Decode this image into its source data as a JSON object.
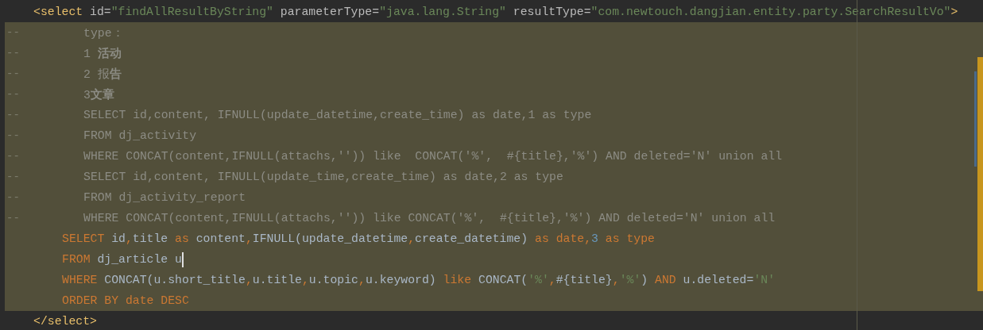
{
  "editor": {
    "lines": [
      {
        "kind": "tag",
        "caret": false,
        "tokens": [
          {
            "text": "<select",
            "kind": "tag"
          },
          {
            "text": " id=",
            "kind": "attr"
          },
          {
            "text": "\"findAllResultByString\"",
            "kind": "value"
          },
          {
            "text": " parameterType=",
            "kind": "attr"
          },
          {
            "text": "\"java.lang.String\"",
            "kind": "value"
          },
          {
            "text": " resultType=",
            "kind": "attr"
          },
          {
            "text": "\"com.newtouch.dangjian.entity.party.SearchResultVo\"",
            "kind": "value"
          },
          {
            "text": ">",
            "kind": "tag"
          }
        ]
      },
      {
        "kind": "comment",
        "caret": false,
        "marker": "--",
        "text": "type："
      },
      {
        "kind": "comment",
        "caret": false,
        "marker": "--",
        "text": "1 **活动**"
      },
      {
        "kind": "comment",
        "caret": false,
        "marker": "--",
        "text": "2 报**告**"
      },
      {
        "kind": "comment",
        "caret": false,
        "marker": "--",
        "text": "3**文章**"
      },
      {
        "kind": "comment",
        "caret": false,
        "marker": "--",
        "text": "SELECT id,content, IFNULL(update_datetime,create_time) as date,1 as type"
      },
      {
        "kind": "comment",
        "caret": false,
        "marker": "--",
        "text": "FROM dj_activity"
      },
      {
        "kind": "comment",
        "caret": false,
        "marker": "--",
        "text": "WHERE CONCAT(content,IFNULL(attachs,'')) like  CONCAT('%',  #{title},'%') AND deleted='N' union all"
      },
      {
        "kind": "comment",
        "caret": false,
        "marker": "--",
        "text": "SELECT id,content, IFNULL(update_time,create_time) as date,2 as type"
      },
      {
        "kind": "comment",
        "caret": false,
        "marker": "--",
        "text": "FROM dj_activity_report"
      },
      {
        "kind": "comment",
        "caret": false,
        "marker": "--",
        "text": "WHERE CONCAT(content,IFNULL(attachs,'')) like CONCAT('%',  #{title},'%') AND deleted='N' union all"
      },
      {
        "kind": "code",
        "caret": false,
        "tokens": [
          {
            "text": "SELECT",
            "kind": "keyword"
          },
          {
            "text": " id",
            "kind": "plain"
          },
          {
            "text": ",",
            "kind": "keyword"
          },
          {
            "text": "title ",
            "kind": "plain"
          },
          {
            "text": "as",
            "kind": "keyword"
          },
          {
            "text": " content",
            "kind": "plain"
          },
          {
            "text": ",",
            "kind": "keyword"
          },
          {
            "text": "IFNULL(update_datetime",
            "kind": "plain"
          },
          {
            "text": ",",
            "kind": "keyword"
          },
          {
            "text": "create_datetime) ",
            "kind": "plain"
          },
          {
            "text": "as date,",
            "kind": "keyword"
          },
          {
            "text": "3",
            "kind": "number"
          },
          {
            "text": " as type",
            "kind": "keyword"
          }
        ]
      },
      {
        "kind": "code",
        "caret": true,
        "tokens": [
          {
            "text": "FROM",
            "kind": "keyword"
          },
          {
            "text": " dj_article u",
            "kind": "plain"
          }
        ]
      },
      {
        "kind": "code",
        "caret": false,
        "tokens": [
          {
            "text": "WHERE",
            "kind": "keyword"
          },
          {
            "text": " CONCAT(u.short_title",
            "kind": "plain"
          },
          {
            "text": ",",
            "kind": "keyword"
          },
          {
            "text": "u.title",
            "kind": "plain"
          },
          {
            "text": ",",
            "kind": "keyword"
          },
          {
            "text": "u.topic",
            "kind": "plain"
          },
          {
            "text": ",",
            "kind": "keyword"
          },
          {
            "text": "u.keyword) ",
            "kind": "plain"
          },
          {
            "text": "like",
            "kind": "keyword"
          },
          {
            "text": " CONCAT(",
            "kind": "plain"
          },
          {
            "text": "'%'",
            "kind": "value"
          },
          {
            "text": ",",
            "kind": "keyword"
          },
          {
            "text": "#{title}",
            "kind": "plain"
          },
          {
            "text": ",",
            "kind": "keyword"
          },
          {
            "text": "'%'",
            "kind": "value"
          },
          {
            "text": ") ",
            "kind": "plain"
          },
          {
            "text": "AND",
            "kind": "keyword"
          },
          {
            "text": " u.deleted=",
            "kind": "plain"
          },
          {
            "text": "'N'",
            "kind": "value"
          }
        ]
      },
      {
        "kind": "code",
        "caret": false,
        "tokens": [
          {
            "text": "ORDER BY date DESC",
            "kind": "keyword"
          }
        ]
      },
      {
        "kind": "tag",
        "caret": false,
        "tokens": [
          {
            "text": "</select>",
            "kind": "tag"
          }
        ]
      }
    ]
  }
}
